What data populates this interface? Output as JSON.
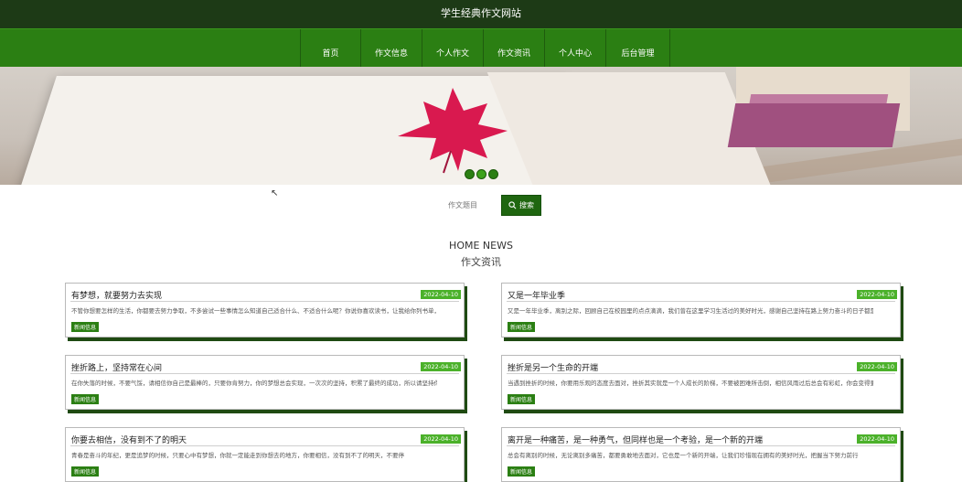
{
  "site_title": "学生经典作文网站",
  "nav": [
    {
      "label": "首页"
    },
    {
      "label": "作文信息"
    },
    {
      "label": "个人作文"
    },
    {
      "label": "作文资讯"
    },
    {
      "label": "个人中心"
    },
    {
      "label": "后台管理"
    }
  ],
  "search": {
    "label": "作文题目",
    "button": "搜索"
  },
  "section": {
    "title": "HOME NEWS",
    "subtitle": "作文资讯"
  },
  "news": [
    {
      "title": "有梦想，就要努力去实现",
      "date": "2022-04-10",
      "desc": "不管你想要怎样的生活，你都要去努力争取，不多尝试一些事情怎么知道自己适合什么、不适合什么呢？你说你喜欢读书，让我给你列书单，你还",
      "tag": "新闻信息"
    },
    {
      "title": "又是一年毕业季",
      "date": "2022-04-10",
      "desc": "又是一年毕业季，离别之际，回顾自己在校园里的点点滴滴，我们曾在这里学习生活过的美好时光，感谢自己坚持在路上努力奋斗的日子都是值得的",
      "tag": "新闻信息"
    },
    {
      "title": "挫折路上，坚持常在心间",
      "date": "2022-04-10",
      "desc": "在你失落的时候，不要气馁，请相信你自己是最棒的，只要你肯努力，你的梦想总会实现，一次次的坚持，积累了最终的成功，所以请坚持你的梦想和追求",
      "tag": "新闻信息"
    },
    {
      "title": "挫折是另一个生命的开端",
      "date": "2022-04-10",
      "desc": "当遇到挫折的时候，你要用乐观的态度去面对，挫折其实就是一个人成长的阶梯，不要被困难所击倒，相信风雨过后总会有彩虹，你会变得更坚强",
      "tag": "新闻信息"
    },
    {
      "title": "你要去相信，没有到不了的明天",
      "date": "2022-04-10",
      "desc": "青春是奋斗的年纪，更是追梦的时候，只要心中有梦想，你就一定能走到你想去的地方，你要相信，没有到不了的明天，不要停",
      "tag": "新闻信息"
    },
    {
      "title": "离开是一种痛苦，是一种勇气，但同样也是一个考验，是一个新的开端",
      "date": "2022-04-10",
      "desc": "总会有离别的时候，无论离别多痛苦，都要勇敢地去面对，它也是一个新的开端，让我们珍惜现在拥有的美好时光，把握当下努力前行",
      "tag": "新闻信息"
    }
  ]
}
